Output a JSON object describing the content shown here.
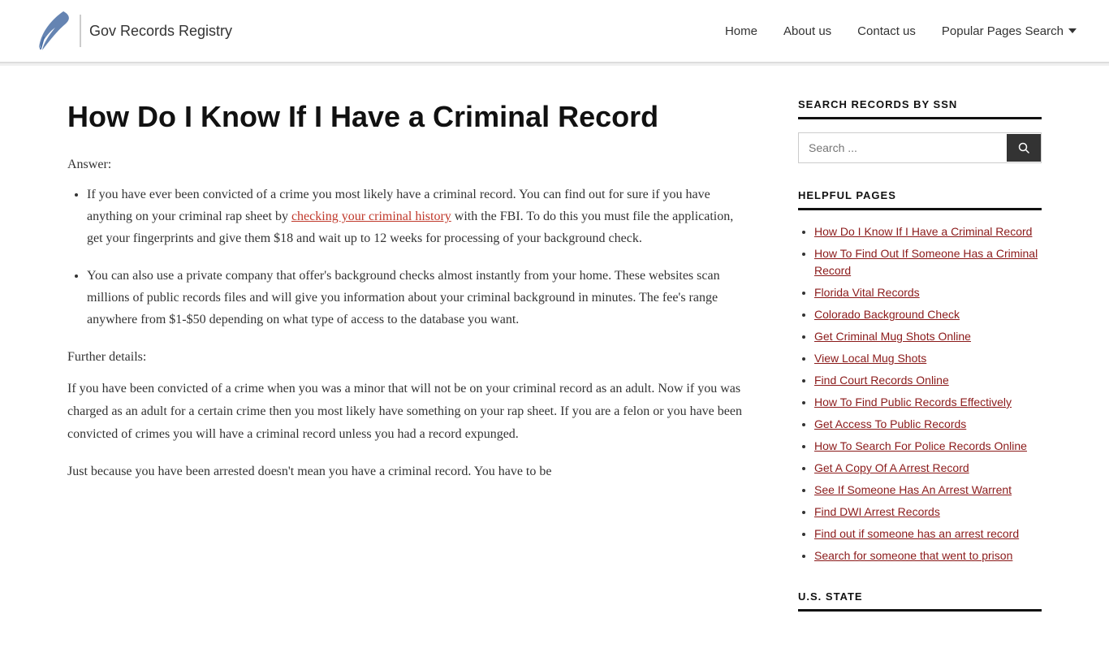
{
  "site": {
    "logo_text": "Gov Records Registry",
    "nav_items": [
      {
        "label": "Home",
        "href": "#"
      },
      {
        "label": "About us",
        "href": "#"
      },
      {
        "label": "Contact us",
        "href": "#"
      },
      {
        "label": "Popular Pages Search",
        "href": "#",
        "dropdown": true
      }
    ]
  },
  "article": {
    "title": "How Do I Know If I Have a Criminal Record",
    "answer_label": "Answer:",
    "bullet_1_text1": "If you have ever been convicted of a crime you most likely have a criminal record. You can find out for sure if you have anything on your criminal rap sheet by ",
    "bullet_1_link_text": "checking your criminal history",
    "bullet_1_text2": " with the FBI. To do this you must file the application, get your fingerprints and give them $18 and wait up to 12 weeks for processing of your background check.",
    "bullet_2": "You can also use a private company that offer's background checks almost instantly from your home. These websites scan millions of public records files and will give you information about your criminal background in minutes. The fee's range anywhere from $1-$50 depending on what type of access to the database you want.",
    "further_details_label": "Further details:",
    "body_text1": "If you have been convicted of a crime when you was a minor that will not be on your criminal record as an adult. Now if you was charged as an  adult for a certain crime then you most likely have something on your rap sheet. If you are a felon or you have been convicted of crimes you will  have a criminal record unless you had a record expunged.",
    "body_text2": "Just because you have been arrested doesn't mean you have a criminal record. You have to be"
  },
  "sidebar": {
    "search_section_title": "SEARCH RECORDS BY SSN",
    "search_placeholder": "Search ...",
    "helpful_section_title": "HELPFUL PAGES",
    "helpful_links": [
      {
        "label": "How Do I Know If I Have a Criminal Record",
        "href": "#"
      },
      {
        "label": "How To Find Out If Someone Has a Criminal Record",
        "href": "#"
      },
      {
        "label": "Florida Vital Records",
        "href": "#"
      },
      {
        "label": "Colorado Background Check",
        "href": "#"
      },
      {
        "label": "Get Criminal Mug Shots Online",
        "href": "#"
      },
      {
        "label": "View Local Mug Shots",
        "href": "#"
      },
      {
        "label": "Find Court Records Online",
        "href": "#"
      },
      {
        "label": "How To Find Public Records Effectively",
        "href": "#"
      },
      {
        "label": "Get Access To Public Records",
        "href": "#"
      },
      {
        "label": "How To Search For Police Records Online",
        "href": "#"
      },
      {
        "label": "Get A Copy Of A Arrest Record",
        "href": "#"
      },
      {
        "label": "See If Someone Has An Arrest Warrent",
        "href": "#"
      },
      {
        "label": "Find DWI Arrest Records",
        "href": "#"
      },
      {
        "label": "Find out if someone has an arrest record",
        "href": "#"
      },
      {
        "label": "Search for someone that went to prison",
        "href": "#"
      }
    ],
    "us_state_title": "U.S. STATE",
    "search_button_label": "🔍"
  }
}
